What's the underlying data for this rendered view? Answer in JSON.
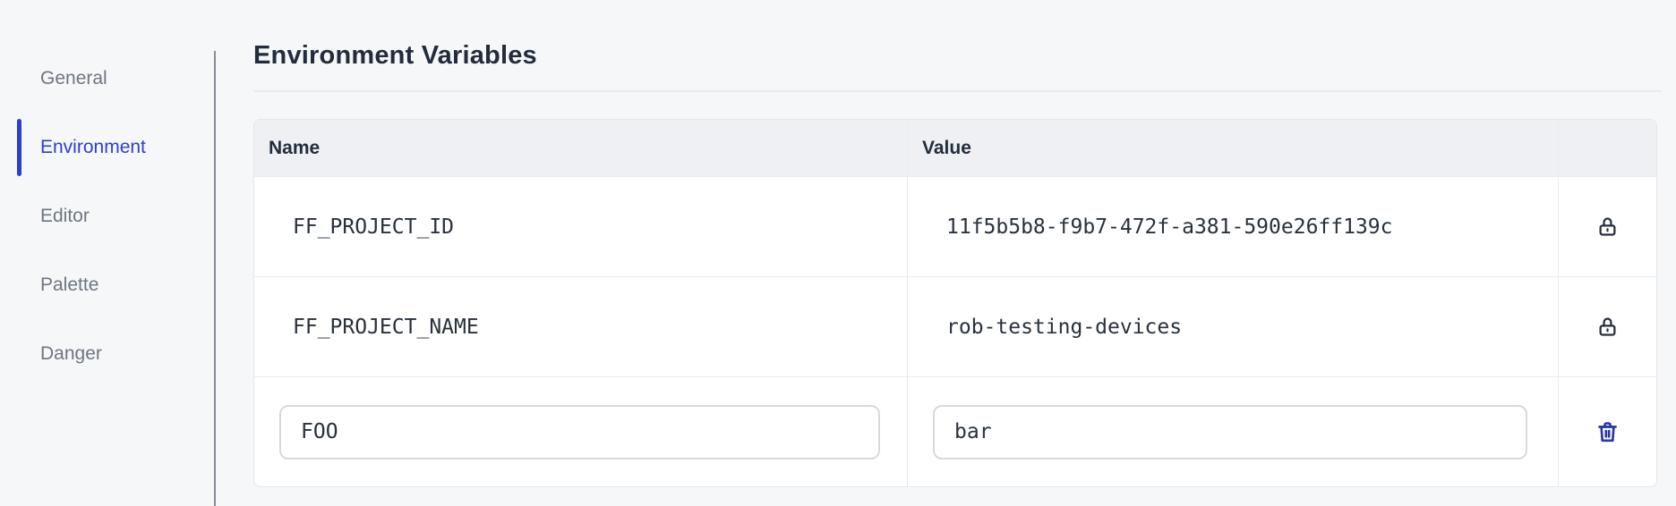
{
  "sidebar": {
    "items": [
      {
        "label": "General",
        "active": false
      },
      {
        "label": "Environment",
        "active": true
      },
      {
        "label": "Editor",
        "active": false
      },
      {
        "label": "Palette",
        "active": false
      },
      {
        "label": "Danger",
        "active": false
      }
    ]
  },
  "main": {
    "title": "Environment Variables",
    "table": {
      "columns": {
        "name": "Name",
        "value": "Value",
        "actions": ""
      },
      "rows": [
        {
          "name": "FF_PROJECT_ID",
          "value": "11f5b5b8-f9b7-472f-a381-590e26ff139c",
          "state": "locked",
          "action_icon": "lock-icon"
        },
        {
          "name": "FF_PROJECT_NAME",
          "value": "rob-testing-devices",
          "state": "locked",
          "action_icon": "lock-icon"
        },
        {
          "name": "FOO",
          "value": "bar",
          "state": "editable",
          "action_icon": "trash-icon"
        }
      ]
    }
  },
  "colors": {
    "accent_blue": "#2b3fcf",
    "trash_blue": "#2a399f",
    "icon_dark": "#242e3e",
    "text_dark": "#222c3c",
    "text_gray": "#6e7680",
    "page_bg": "#f6f7f9",
    "table_header_bg": "#eff0f3",
    "border": "#e9ebee"
  }
}
